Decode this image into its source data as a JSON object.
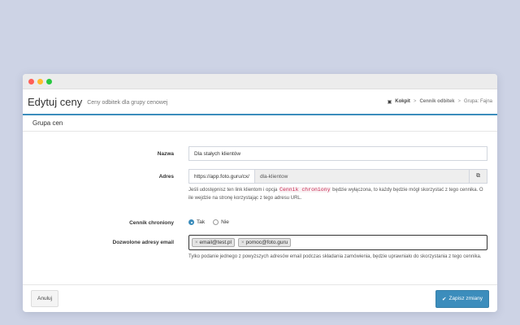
{
  "window": {
    "controls": [
      "close",
      "minimize",
      "maximize"
    ]
  },
  "header": {
    "title": "Edytuj ceny",
    "subtitle": "Ceny odbitek dla grupy cenowej",
    "breadcrumb": {
      "icon": "dashboard-icon",
      "home": "Kokpit",
      "item1": "Cennik odbitek",
      "current": "Grupa: Fajna"
    }
  },
  "panel": {
    "title": "Grupa cen"
  },
  "form": {
    "name": {
      "label": "Nazwa",
      "value": "Dla stałych klientów"
    },
    "address": {
      "label": "Adres",
      "prefix": "https://app.foto.guru/cx/",
      "value": "dla-klientow",
      "help_pre": "Jeśli udostępnisz ten link klientom i opcja",
      "help_code": "Cennik chroniony",
      "help_post": "będzie wyłączona, to każdy będzie mógł skorzystać z tego cennika. O ile wejdzie na stronę korzystając z tego adresu URL."
    },
    "protected": {
      "label": "Cennik chroniony",
      "options": [
        "Tak",
        "Nie"
      ],
      "selected": "Tak"
    },
    "emails": {
      "label": "Dozwolone adresy email",
      "tags": [
        "email@test.pl",
        "pomoc@foto.guru"
      ],
      "tag_remove": "×",
      "help": "Tylko podanie jednego z powyższych adresów email podczas składania zamówienia, będzie uprawniało do skorzystania z tego cennika."
    }
  },
  "footer": {
    "cancel_label": "Anuluj",
    "save_label": "Zapisz zmiany"
  },
  "colors": {
    "accent": "#3c8dbc",
    "background": "#cdd3e5",
    "code": "#c7254e"
  }
}
